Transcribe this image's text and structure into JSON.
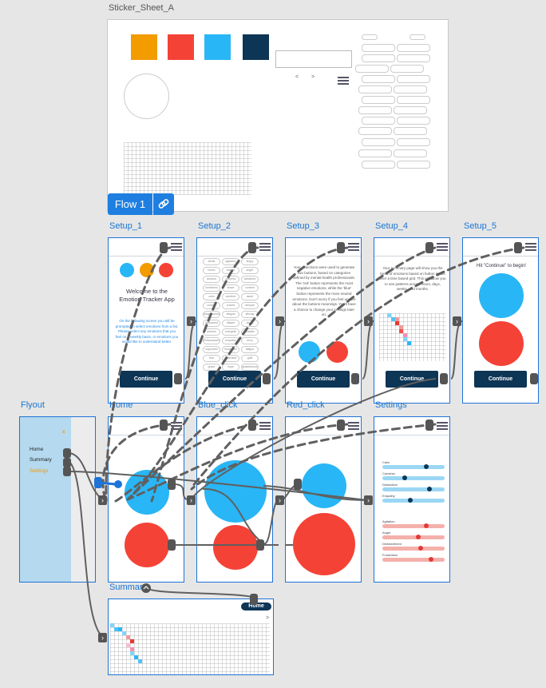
{
  "sticker_sheet": {
    "title": "Sticker_Sheet_A",
    "carousel_prev": "<",
    "carousel_next": ">"
  },
  "flow": {
    "label": "Flow 1",
    "link_icon": "link-icon"
  },
  "colors": {
    "orange": "#f29c00",
    "red": "#f44336",
    "blue": "#29b6f6",
    "navy": "#0c3556",
    "accent": "#1e7fe0"
  },
  "screens": {
    "setup_1": {
      "label": "Setup_1",
      "welcome": "Welcome to the Emotion Tracker App",
      "body": "On the following screen you will be prompted to select emotions from a list. Please select any emotions that you feel on a weekly basis, or emotions you would like to understand better.",
      "button": "Continue"
    },
    "setup_2": {
      "label": "Setup_2",
      "chips": [
        "afraid",
        "agitation",
        "angry",
        "bored",
        "shame",
        "anger",
        "anxious",
        "sadness",
        "ashamed",
        "loneliness",
        "brave",
        "content",
        "calm",
        "carefree",
        "awed",
        "curious",
        "crazed",
        "despair",
        "disappointment",
        "disgust",
        "dismay",
        "delinquent",
        "distant",
        "doubt",
        "dreams",
        "energetic",
        "ecstatic",
        "embarrassment",
        "empathy",
        "envy",
        "expectant",
        "frustration",
        "fatigue",
        "fear",
        "frustrated",
        "guilt",
        "grace",
        "hope",
        "gratefulness"
      ],
      "button": "Continue"
    },
    "setup_3": {
      "label": "Setup_3",
      "body": "Your selections were used to generate two buttons, based on categories defined by mental health professionals. The 'red' button represents the most negative emotions, while the 'blue' button represents the more neutral emotions. Don't worry if you feel unsure about the buttons meanings. You'll have a chance to change your settings later on.",
      "button": "Continue"
    },
    "setup_4": {
      "label": "Setup_4",
      "body": "Your summary page will show you the trend of emotions based on button inputs over a time based grid. This will allow you to see patterns across hours, days, weeks, and months.",
      "button": "Continue"
    },
    "setup_5": {
      "label": "Setup_5",
      "body": "Hit \"Continue\" to begin!",
      "button": "Continue"
    },
    "flyout": {
      "label": "Flyout",
      "close": "x",
      "items": [
        "Home",
        "Summary",
        "Settings"
      ]
    },
    "home": {
      "label": "Home"
    },
    "blue_click": {
      "label": "Blue_click"
    },
    "red_click": {
      "label": "Red_click"
    },
    "settings": {
      "label": "Settings",
      "blue_rows": [
        {
          "label": "Calm",
          "value": 0.72
        },
        {
          "label": "Careless",
          "value": 0.35
        },
        {
          "label": "Distraction",
          "value": 0.78
        },
        {
          "label": "Empathy",
          "value": 0.45
        }
      ],
      "red_rows": [
        {
          "label": "Agitation",
          "value": 0.72
        },
        {
          "label": "Anger",
          "value": 0.58
        },
        {
          "label": "Disheartened",
          "value": 0.62
        },
        {
          "label": "Frustration",
          "value": 0.8
        }
      ]
    },
    "summary": {
      "label": "Summary",
      "home_button": "Home",
      "arrow": ">"
    }
  }
}
